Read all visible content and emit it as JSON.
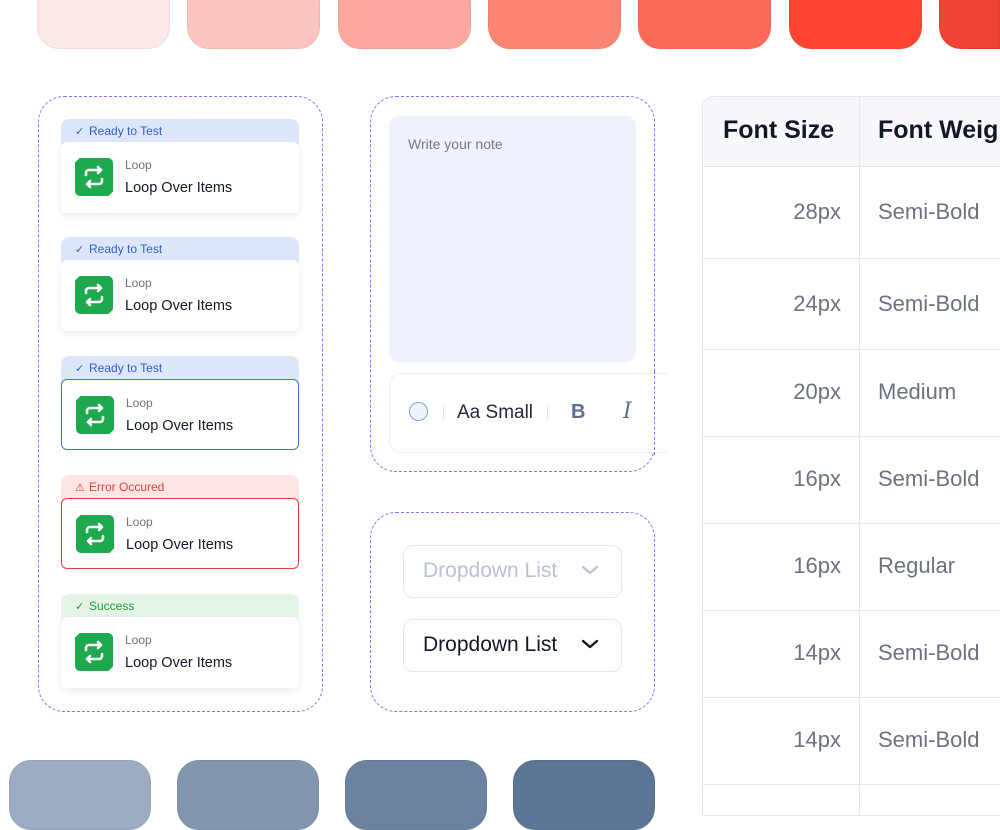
{
  "top_swatches": [
    "#fde8e8",
    "#fcc5c0",
    "#fba99f",
    "#fc8674",
    "#fe6a59",
    "#fe4533",
    "#ef4433"
  ],
  "bottom_swatches": [
    "#9eacc2",
    "#8396b0",
    "#6b82a0",
    "#5d7594"
  ],
  "nodes": [
    {
      "status": "Ready to Test",
      "kind": "Loop",
      "name": "Loop Over Items"
    },
    {
      "status": "Ready to Test",
      "kind": "Loop",
      "name": "Loop Over Items"
    },
    {
      "status": "Ready to Test",
      "kind": "Loop",
      "name": "Loop Over Items"
    },
    {
      "status": "Error Occured",
      "kind": "Loop",
      "name": "Loop Over Items"
    },
    {
      "status": "Success",
      "kind": "Loop",
      "name": "Loop Over Items"
    }
  ],
  "note": {
    "placeholder": "Write your note",
    "size_label": "Aa Small",
    "bold_label": "B",
    "italic_label": "I"
  },
  "dropdowns": {
    "disabled_label": "Dropdown List",
    "enabled_label": "Dropdown List"
  },
  "table": {
    "headers": [
      "Font Size",
      "Font Weight"
    ],
    "rows": [
      {
        "size": "28px",
        "weight": "Semi-Bold"
      },
      {
        "size": "24px",
        "weight": "Semi-Bold"
      },
      {
        "size": "20px",
        "weight": "Medium"
      },
      {
        "size": "16px",
        "weight": "Semi-Bold"
      },
      {
        "size": "16px",
        "weight": "Regular"
      },
      {
        "size": "14px",
        "weight": "Semi-Bold"
      },
      {
        "size": "14px",
        "weight": "Semi-Bold"
      }
    ]
  },
  "colors": {
    "accent": "#3f73d6",
    "error": "#e0423a",
    "success": "#1f9a3a",
    "loop_icon": "#1fa94e",
    "dashed_border": "#9b6cf0"
  }
}
